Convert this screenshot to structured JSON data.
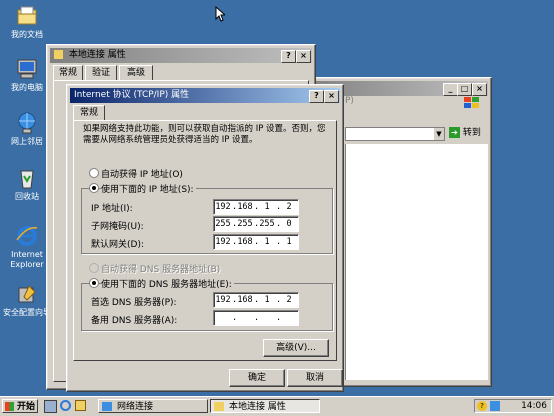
{
  "desktop": {
    "icons": [
      {
        "label": "我的文档",
        "icon": "folder-documents-icon"
      },
      {
        "label": "我的电脑",
        "icon": "computer-icon"
      },
      {
        "label": "网上邻居",
        "icon": "network-icon"
      },
      {
        "label": "回收站",
        "icon": "recycle-bin-icon"
      },
      {
        "label": "Internet Explorer",
        "icon": "ie-icon"
      },
      {
        "label": "安全配置向导",
        "icon": "security-wizard-icon"
      }
    ]
  },
  "props_window": {
    "title": "本地连接 属性",
    "tabs": [
      "常规",
      "验证",
      "高级"
    ]
  },
  "explorer_window": {
    "menu_fragment": "P)",
    "go_label": "转到"
  },
  "tcpip_dialog": {
    "title": "Internet 协议 (TCP/IP) 属性",
    "tab": "常规",
    "intro": "如果网络支持此功能，则可以获取自动指派的 IP 设置。否则，您需要从网络系统管理员处获得适当的 IP 设置。",
    "auto_ip_label": "自动获得 IP 地址(O)",
    "manual_ip_label": "使用下面的 IP 地址(S):",
    "ip_label": "IP 地址(I):",
    "ip_value": [
      "192",
      "168",
      "1",
      "2"
    ],
    "mask_label": "子网掩码(U):",
    "mask_value": [
      "255",
      "255",
      "255",
      "0"
    ],
    "gateway_label": "默认网关(D):",
    "gateway_value": [
      "192",
      "168",
      "1",
      "1"
    ],
    "auto_dns_label": "自动获得 DNS 服务器地址(B)",
    "manual_dns_label": "使用下面的 DNS 服务器地址(E):",
    "dns1_label": "首选 DNS 服务器(P):",
    "dns1_value": [
      "192",
      "168",
      "1",
      "2"
    ],
    "dns2_label": "备用 DNS 服务器(A):",
    "dns2_value": [
      "",
      "",
      "",
      ""
    ],
    "advanced_label": "高级(V)...",
    "ok_label": "确定",
    "cancel_label": "取消"
  },
  "taskbar": {
    "start_label": "开始",
    "items": [
      "网络连接",
      "本地连接 属性"
    ],
    "clock": "14:06"
  }
}
